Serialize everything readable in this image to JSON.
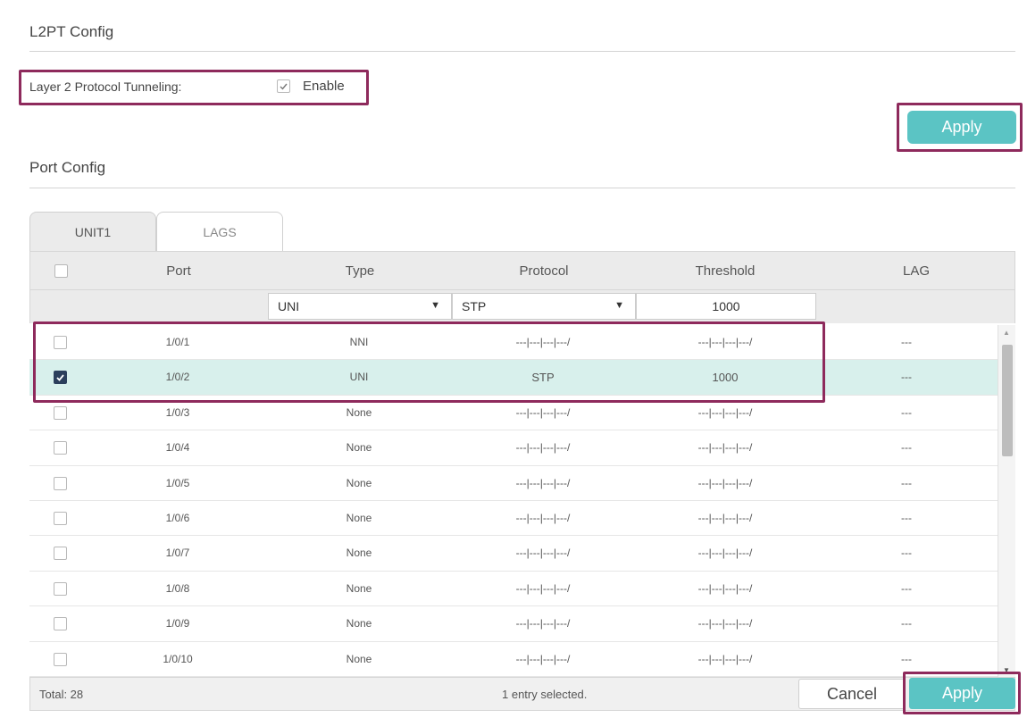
{
  "l2pt": {
    "title": "L2PT Config",
    "tunneling_label": "Layer 2 Protocol Tunneling:",
    "enable_label": "Enable",
    "enable_checked": true,
    "apply_label": "Apply"
  },
  "port_config": {
    "title": "Port Config",
    "tabs": [
      {
        "label": "UNIT1",
        "active": true
      },
      {
        "label": "LAGS",
        "active": false
      }
    ],
    "columns": {
      "port": "Port",
      "type": "Type",
      "protocol": "Protocol",
      "threshold": "Threshold",
      "lag": "LAG"
    },
    "filters": {
      "type": "UNI",
      "protocol": "STP",
      "threshold": "1000"
    },
    "rows": [
      {
        "port": "1/0/1",
        "type": "NNI",
        "protocol": "---|---|---|---/",
        "threshold": "---|---|---|---/",
        "lag": "---",
        "checked": false
      },
      {
        "port": "1/0/2",
        "type": "UNI",
        "protocol": "STP",
        "threshold": "1000",
        "lag": "---",
        "checked": true
      },
      {
        "port": "1/0/3",
        "type": "None",
        "protocol": "---|---|---|---/",
        "threshold": "---|---|---|---/",
        "lag": "---",
        "checked": false
      },
      {
        "port": "1/0/4",
        "type": "None",
        "protocol": "---|---|---|---/",
        "threshold": "---|---|---|---/",
        "lag": "---",
        "checked": false
      },
      {
        "port": "1/0/5",
        "type": "None",
        "protocol": "---|---|---|---/",
        "threshold": "---|---|---|---/",
        "lag": "---",
        "checked": false
      },
      {
        "port": "1/0/6",
        "type": "None",
        "protocol": "---|---|---|---/",
        "threshold": "---|---|---|---/",
        "lag": "---",
        "checked": false
      },
      {
        "port": "1/0/7",
        "type": "None",
        "protocol": "---|---|---|---/",
        "threshold": "---|---|---|---/",
        "lag": "---",
        "checked": false
      },
      {
        "port": "1/0/8",
        "type": "None",
        "protocol": "---|---|---|---/",
        "threshold": "---|---|---|---/",
        "lag": "---",
        "checked": false
      },
      {
        "port": "1/0/9",
        "type": "None",
        "protocol": "---|---|---|---/",
        "threshold": "---|---|---|---/",
        "lag": "---",
        "checked": false
      },
      {
        "port": "1/0/10",
        "type": "None",
        "protocol": "---|---|---|---/",
        "threshold": "---|---|---|---/",
        "lag": "---",
        "checked": false
      }
    ],
    "footer": {
      "total": "Total: 28",
      "selected": "1 entry selected.",
      "cancel_label": "Cancel",
      "apply_label": "Apply"
    }
  },
  "colors": {
    "accent": "#5bc4c4",
    "highlight": "#8e2a5c",
    "selected_row": "#d8f0ec",
    "checkbox_checked": "#2b3f5c"
  }
}
